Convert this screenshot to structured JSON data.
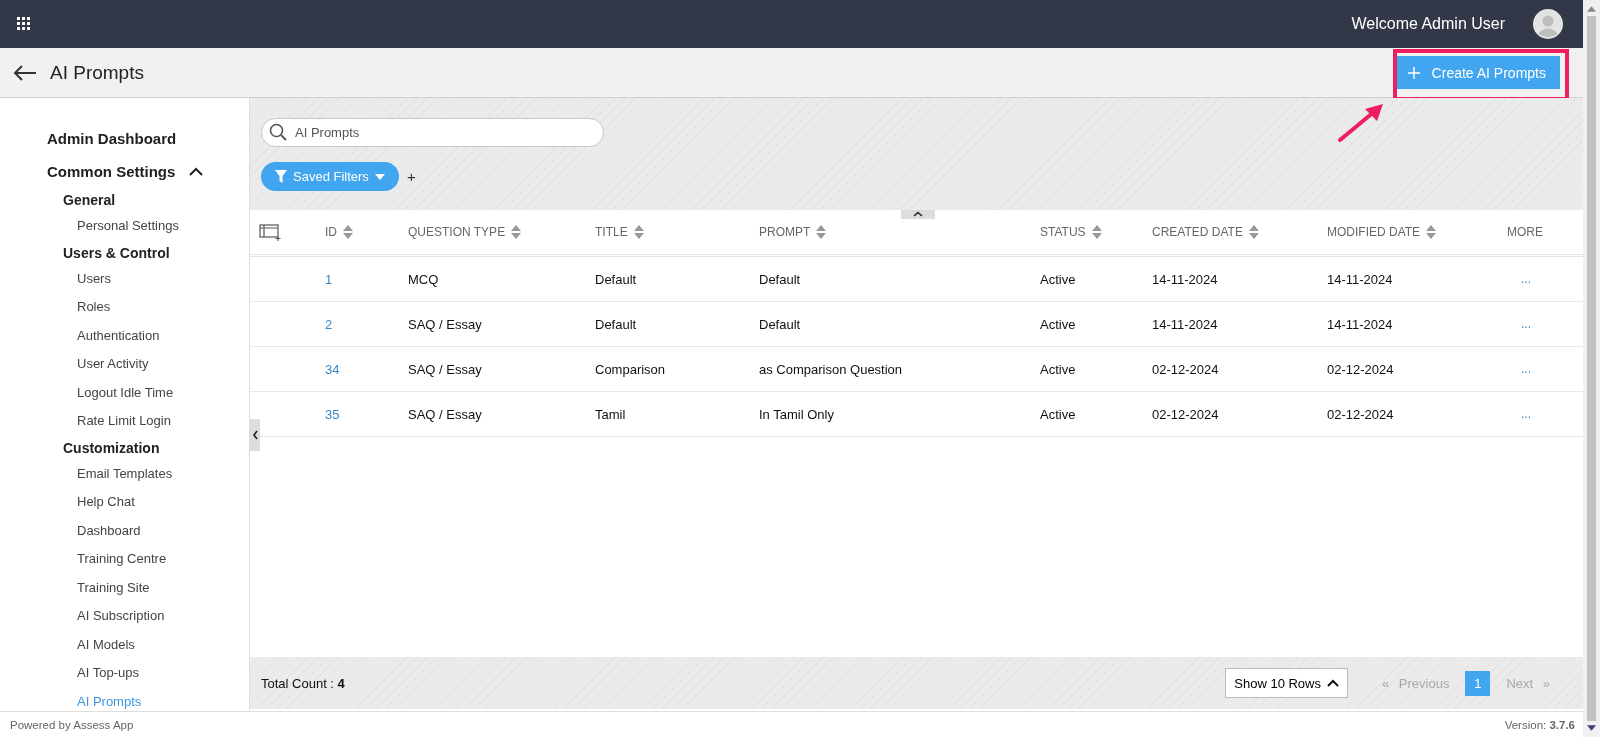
{
  "top_bar": {
    "welcome": "Welcome Admin User"
  },
  "header": {
    "title": "AI Prompts",
    "create_button": "Create AI Prompts",
    "highlighted": true
  },
  "sidebar": {
    "items": [
      {
        "label": "Admin Dashboard"
      },
      {
        "label": "Common Settings",
        "expanded": true,
        "children": [
          {
            "label": "General",
            "children": [
              {
                "label": "Personal Settings",
                "selected": false
              }
            ]
          },
          {
            "label": "Users & Control",
            "children": [
              {
                "label": "Users",
                "selected": false
              },
              {
                "label": "Roles",
                "selected": false
              },
              {
                "label": "Authentication",
                "selected": false
              },
              {
                "label": "User Activity",
                "selected": false
              },
              {
                "label": "Logout Idle Time",
                "selected": false
              },
              {
                "label": "Rate Limit Login",
                "selected": false
              }
            ]
          },
          {
            "label": "Customization",
            "children": [
              {
                "label": "Email Templates",
                "selected": false
              },
              {
                "label": "Help Chat",
                "selected": false
              },
              {
                "label": "Dashboard",
                "selected": false
              },
              {
                "label": "Training Centre",
                "selected": false
              },
              {
                "label": "Training Site",
                "selected": false
              },
              {
                "label": "AI Subscription",
                "selected": false
              },
              {
                "label": "AI Models",
                "selected": false
              },
              {
                "label": "AI Top-ups",
                "selected": false
              },
              {
                "label": "AI Prompts",
                "selected": true
              }
            ]
          }
        ]
      }
    ]
  },
  "search": {
    "value": "AI Prompts"
  },
  "saved_filters": {
    "label": "Saved Filters",
    "add": "+"
  },
  "table": {
    "columns": [
      {
        "label": "ID",
        "sortable": true
      },
      {
        "label": "QUESTION TYPE",
        "sortable": true
      },
      {
        "label": "TITLE",
        "sortable": true
      },
      {
        "label": "PROMPT",
        "sortable": true
      },
      {
        "label": "STATUS",
        "sortable": true
      },
      {
        "label": "CREATED DATE",
        "sortable": true
      },
      {
        "label": "MODIFIED DATE",
        "sortable": true
      },
      {
        "label": "MORE",
        "sortable": false
      }
    ],
    "rows": [
      {
        "cells": [
          "1",
          "MCQ",
          "Default",
          "Default",
          "Active",
          "14-11-2024",
          "14-11-2024"
        ],
        "more": "..."
      },
      {
        "cells": [
          "2",
          "SAQ / Essay",
          "Default",
          "Default",
          "Active",
          "14-11-2024",
          "14-11-2024"
        ],
        "more": "..."
      },
      {
        "cells": [
          "34",
          "SAQ / Essay",
          "Comparison",
          "as Comparison Question",
          "Active",
          "02-12-2024",
          "02-12-2024"
        ],
        "more": "..."
      },
      {
        "cells": [
          "35",
          "SAQ / Essay",
          "Tamil",
          "In Tamil Only",
          "Active",
          "02-12-2024",
          "02-12-2024"
        ],
        "more": "..."
      }
    ]
  },
  "table_footer": {
    "total_label": "Total Count : ",
    "total": "4",
    "rows_select": "Show 10 Rows",
    "previous_arrow": "«",
    "previous": "Previous",
    "next": "Next",
    "next_arrow": "»",
    "previous_disabled": true,
    "next_disabled": true,
    "pages": [
      {
        "label": "1",
        "selected": true
      }
    ]
  },
  "footer": {
    "powered": "Powered by Assess App",
    "version_label": "Version: ",
    "version": "3.7.6"
  }
}
